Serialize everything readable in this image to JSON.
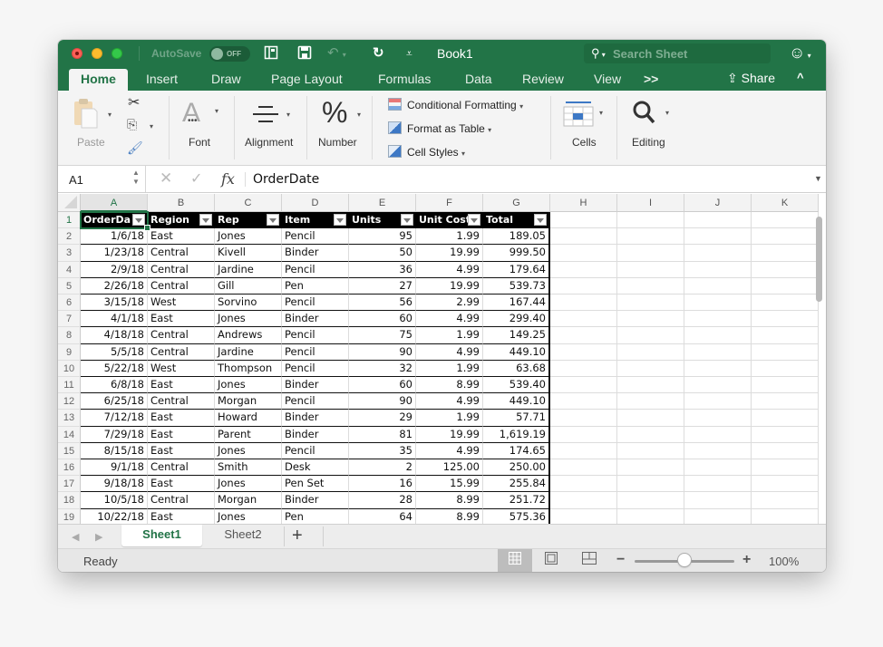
{
  "titlebar": {
    "autosave_label": "AutoSave",
    "autosave_state": "OFF",
    "document_title": "Book1",
    "search_placeholder": "Search Sheet",
    "icons": [
      "sidebar-icon",
      "save-icon",
      "undo-icon",
      "redo-icon",
      "customize-toolbar-icon",
      "smiley-feedback-icon"
    ]
  },
  "ribbon_tabs": [
    "Home",
    "Insert",
    "Draw",
    "Page Layout",
    "Formulas",
    "Data",
    "Review",
    "View",
    ">>"
  ],
  "active_tab": "Home",
  "share_label": "Share",
  "ribbon": {
    "paste": "Paste",
    "font": "Font",
    "alignment": "Alignment",
    "number": "Number",
    "conditional_formatting": "Conditional Formatting",
    "format_as_table": "Format as Table",
    "cell_styles": "Cell Styles",
    "cells": "Cells",
    "editing": "Editing"
  },
  "formula_bar": {
    "name_box": "A1",
    "fx_label": "fx",
    "value": "OrderDate"
  },
  "grid": {
    "columns": [
      "A",
      "B",
      "C",
      "D",
      "E",
      "F",
      "G",
      "H",
      "I",
      "J",
      "K"
    ],
    "selected_column": "A",
    "header_row": [
      "OrderDa",
      "Region",
      "Rep",
      "Item",
      "Units",
      "Unit Cost",
      "Total"
    ],
    "rows": [
      [
        "1/6/18",
        "East",
        "Jones",
        "Pencil",
        "95",
        "1.99",
        "189.05"
      ],
      [
        "1/23/18",
        "Central",
        "Kivell",
        "Binder",
        "50",
        "19.99",
        "999.50"
      ],
      [
        "2/9/18",
        "Central",
        "Jardine",
        "Pencil",
        "36",
        "4.99",
        "179.64"
      ],
      [
        "2/26/18",
        "Central",
        "Gill",
        "Pen",
        "27",
        "19.99",
        "539.73"
      ],
      [
        "3/15/18",
        "West",
        "Sorvino",
        "Pencil",
        "56",
        "2.99",
        "167.44"
      ],
      [
        "4/1/18",
        "East",
        "Jones",
        "Binder",
        "60",
        "4.99",
        "299.40"
      ],
      [
        "4/18/18",
        "Central",
        "Andrews",
        "Pencil",
        "75",
        "1.99",
        "149.25"
      ],
      [
        "5/5/18",
        "Central",
        "Jardine",
        "Pencil",
        "90",
        "4.99",
        "449.10"
      ],
      [
        "5/22/18",
        "West",
        "Thompson",
        "Pencil",
        "32",
        "1.99",
        "63.68"
      ],
      [
        "6/8/18",
        "East",
        "Jones",
        "Binder",
        "60",
        "8.99",
        "539.40"
      ],
      [
        "6/25/18",
        "Central",
        "Morgan",
        "Pencil",
        "90",
        "4.99",
        "449.10"
      ],
      [
        "7/12/18",
        "East",
        "Howard",
        "Binder",
        "29",
        "1.99",
        "57.71"
      ],
      [
        "7/29/18",
        "East",
        "Parent",
        "Binder",
        "81",
        "19.99",
        "1,619.19"
      ],
      [
        "8/15/18",
        "East",
        "Jones",
        "Pencil",
        "35",
        "4.99",
        "174.65"
      ],
      [
        "9/1/18",
        "Central",
        "Smith",
        "Desk",
        "2",
        "125.00",
        "250.00"
      ],
      [
        "9/18/18",
        "East",
        "Jones",
        "Pen Set",
        "16",
        "15.99",
        "255.84"
      ],
      [
        "10/5/18",
        "Central",
        "Morgan",
        "Binder",
        "28",
        "8.99",
        "251.72"
      ],
      [
        "10/22/18",
        "East",
        "Jones",
        "Pen",
        "64",
        "8.99",
        "575.36"
      ]
    ],
    "numeric_columns": [
      0,
      4,
      5,
      6
    ]
  },
  "sheet_tabs": [
    "Sheet1",
    "Sheet2"
  ],
  "active_sheet": "Sheet1",
  "add_sheet_label": "+",
  "status": {
    "ready": "Ready",
    "zoom_percent_label": "100%",
    "zoom_fraction": 0.5,
    "views": [
      "normal-view",
      "page-layout-view",
      "page-break-view"
    ],
    "active_view": "normal-view"
  }
}
